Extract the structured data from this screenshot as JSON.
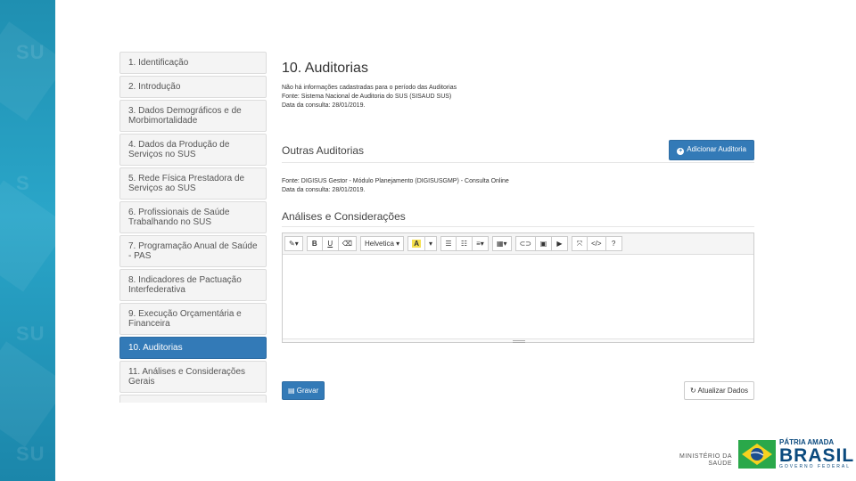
{
  "sidebar": {
    "items": [
      {
        "label": "1. Identificação"
      },
      {
        "label": "2. Introdução"
      },
      {
        "label": "3. Dados Demográficos e de Morbimortalidade"
      },
      {
        "label": "4. Dados da Produção de Serviços no SUS"
      },
      {
        "label": "5. Rede Física Prestadora de Serviços ao SUS"
      },
      {
        "label": "6. Profissionais de Saúde Trabalhando no SUS"
      },
      {
        "label": "7. Programação Anual de Saúde - PAS"
      },
      {
        "label": "8. Indicadores de Pactuação Interfederativa"
      },
      {
        "label": "9. Execução Orçamentária e Financeira"
      },
      {
        "label": "10. Auditorias"
      },
      {
        "label": "11. Análises e Considerações Gerais"
      }
    ],
    "active_index": 9
  },
  "main": {
    "title": "10. Auditorias",
    "info_lines": [
      "Não há informações cadastradas para o período das Auditorias",
      "Fonte: Sistema Nacional de Auditoria do SUS (SISAUD SUS)",
      "Data da consulta: 28/01/2019."
    ],
    "other_title": "Outras Auditorias",
    "add_button": "Adicionar Auditoria",
    "other_lines": [
      "Fonte: DIGISUS Gestor - Módulo Planejamento (DIGISUSGMP) - Consulta Online",
      "Data da consulta: 28/01/2019."
    ],
    "analysis_title": "Análises e Considerações",
    "save_button": "Gravar",
    "update_button": "Atualizar Dados"
  },
  "editor": {
    "font_name": "Helvetica",
    "bold": "B",
    "underline": "U",
    "help": "?",
    "code": "</>"
  },
  "footer": {
    "ministry_line1": "MINISTÉRIO DA",
    "ministry_line2": "SAÚDE",
    "brand_line1": "PÁTRIA AMADA",
    "brand_line2": "BRASIL",
    "brand_line3": "GOVERNO FEDERAL"
  },
  "colors": {
    "primary": "#337ab7",
    "band": "#2aa6c9",
    "brand_blue": "#0b4a7e",
    "brand_green": "#2aa84a",
    "brand_yellow": "#f6d21f"
  }
}
